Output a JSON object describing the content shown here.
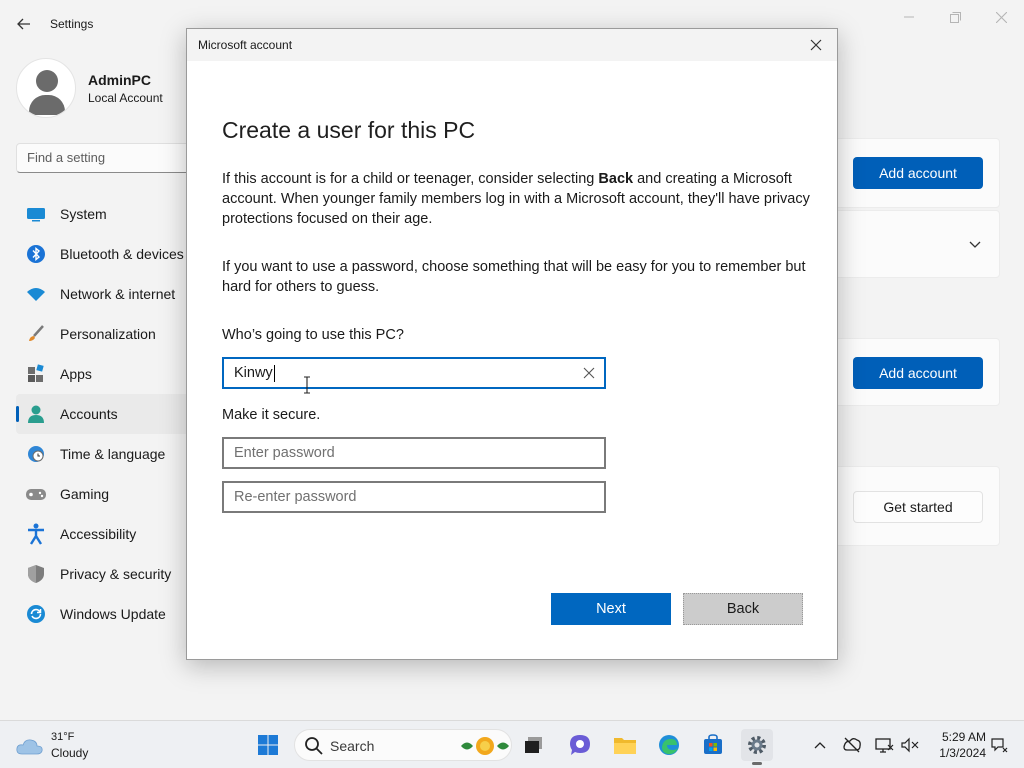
{
  "settings": {
    "title": "Settings",
    "profile": {
      "name": "AdminPC",
      "type": "Local Account"
    },
    "search_placeholder": "Find a setting",
    "nav": [
      {
        "label": "System",
        "icon": "system-icon"
      },
      {
        "label": "Bluetooth & devices",
        "icon": "bluetooth-icon"
      },
      {
        "label": "Network & internet",
        "icon": "wifi-icon"
      },
      {
        "label": "Personalization",
        "icon": "brush-icon"
      },
      {
        "label": "Apps",
        "icon": "apps-icon"
      },
      {
        "label": "Accounts",
        "icon": "accounts-icon",
        "active": true
      },
      {
        "label": "Time & language",
        "icon": "globe-clock-icon"
      },
      {
        "label": "Gaming",
        "icon": "gamepad-icon"
      },
      {
        "label": "Accessibility",
        "icon": "accessibility-icon"
      },
      {
        "label": "Privacy & security",
        "icon": "shield-icon"
      },
      {
        "label": "Windows Update",
        "icon": "update-icon"
      }
    ],
    "cards": {
      "add_account_1": "Add account",
      "add_account_2": "Add account",
      "get_started": "Get started"
    }
  },
  "dialog": {
    "title": "Microsoft account",
    "heading": "Create a user for this PC",
    "para1_before": "If this account is for a child or teenager, consider selecting ",
    "para1_bold": "Back",
    "para1_after": " and creating a Microsoft account. When younger family members log in with a Microsoft account, they'll have privacy protections focused on their age.",
    "para2": "If you want to use a password, choose something that will be easy for you to remember but hard for others to guess.",
    "who_label": "Who’s going to use this PC?",
    "username_value": "Kinwy",
    "secure_label": "Make it secure.",
    "password_placeholder": "Enter password",
    "reenter_placeholder": "Re-enter password",
    "next_label": "Next",
    "back_label": "Back"
  },
  "taskbar": {
    "weather_temp": "31°F",
    "weather_desc": "Cloudy",
    "search_label": "Search",
    "time": "5:29 AM",
    "date": "1/3/2024"
  },
  "colors": {
    "accent": "#0067c0",
    "accent_settings": "#005fb8",
    "back_button": "#cccccc"
  }
}
